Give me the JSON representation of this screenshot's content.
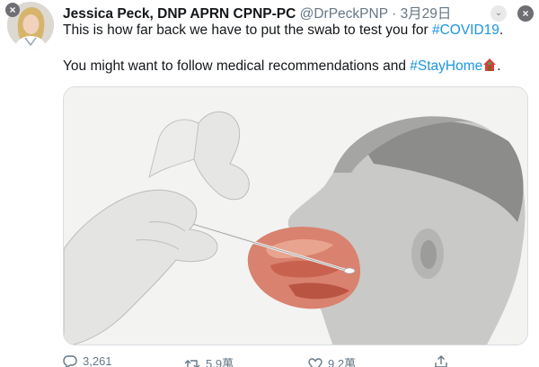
{
  "tweet": {
    "author_name": "Jessica Peck, DNP APRN CPNP-PC",
    "handle": "@DrPeckPNP",
    "separator": "·",
    "date": "3月29日",
    "text_line1_prefix": "This is how far back we have to put the swab to test you for ",
    "hashtag_covid": "#COVID19",
    "text_line1_suffix": ".",
    "text_line2_prefix": "You might want to follow medical recommendations and ",
    "hashtag_stayhome": "#StayHome",
    "text_line2_suffix": "."
  },
  "actions": {
    "reply_count": "3,261",
    "retweet_count": "5.9萬",
    "like_count": "9.2萬"
  },
  "icons": {
    "close": "close-icon",
    "caret": "chevron-down-icon",
    "reply": "reply-icon",
    "retweet": "retweet-icon",
    "like": "heart-icon",
    "share": "share-icon",
    "house": "house-emoji-icon"
  },
  "colors": {
    "hashtag": "#1b95e0",
    "muted": "#657786",
    "text": "#14171a"
  }
}
